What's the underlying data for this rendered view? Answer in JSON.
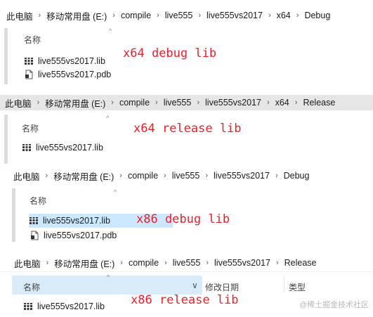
{
  "sep_glyph": "›",
  "sort_glyph": "^",
  "chevron_glyph": "∨",
  "accent_color": "#e8202a",
  "panels": [
    {
      "breadcrumb": [
        "此电脑",
        "移动常用盘 (E:)",
        "compile",
        "live555",
        "live555vs2017",
        "x64",
        "Debug"
      ],
      "columns": [
        "名称"
      ],
      "files": [
        {
          "name": "live555vs2017.lib",
          "icon": "lib-file-icon"
        },
        {
          "name": "live555vs2017.pdb",
          "icon": "pdb-file-icon"
        }
      ],
      "note": "x64 debug lib"
    },
    {
      "breadcrumb": [
        "此电脑",
        "移动常用盘 (E:)",
        "compile",
        "live555",
        "live555vs2017",
        "x64",
        "Release"
      ],
      "columns": [
        "名称"
      ],
      "files": [
        {
          "name": "live555vs2017.lib",
          "icon": "lib-file-icon"
        }
      ],
      "note": "x64 release lib"
    },
    {
      "breadcrumb": [
        "此电脑",
        "移动常用盘 (E:)",
        "compile",
        "live555",
        "live555vs2017",
        "Debug"
      ],
      "columns": [
        "名称"
      ],
      "files": [
        {
          "name": "live555vs2017.lib",
          "icon": "lib-file-icon"
        },
        {
          "name": "live555vs2017.pdb",
          "icon": "pdb-file-icon"
        }
      ],
      "note": "x86 debug lib"
    },
    {
      "breadcrumb": [
        "此电脑",
        "移动常用盘 (E:)",
        "compile",
        "live555",
        "live555vs2017",
        "Release"
      ],
      "columns": [
        "名称",
        "修改日期",
        "类型"
      ],
      "files": [
        {
          "name": "live555vs2017.lib",
          "icon": "lib-file-icon"
        }
      ],
      "note": "x86 release lib"
    }
  ],
  "watermark": "@稀土掘金技术社区"
}
